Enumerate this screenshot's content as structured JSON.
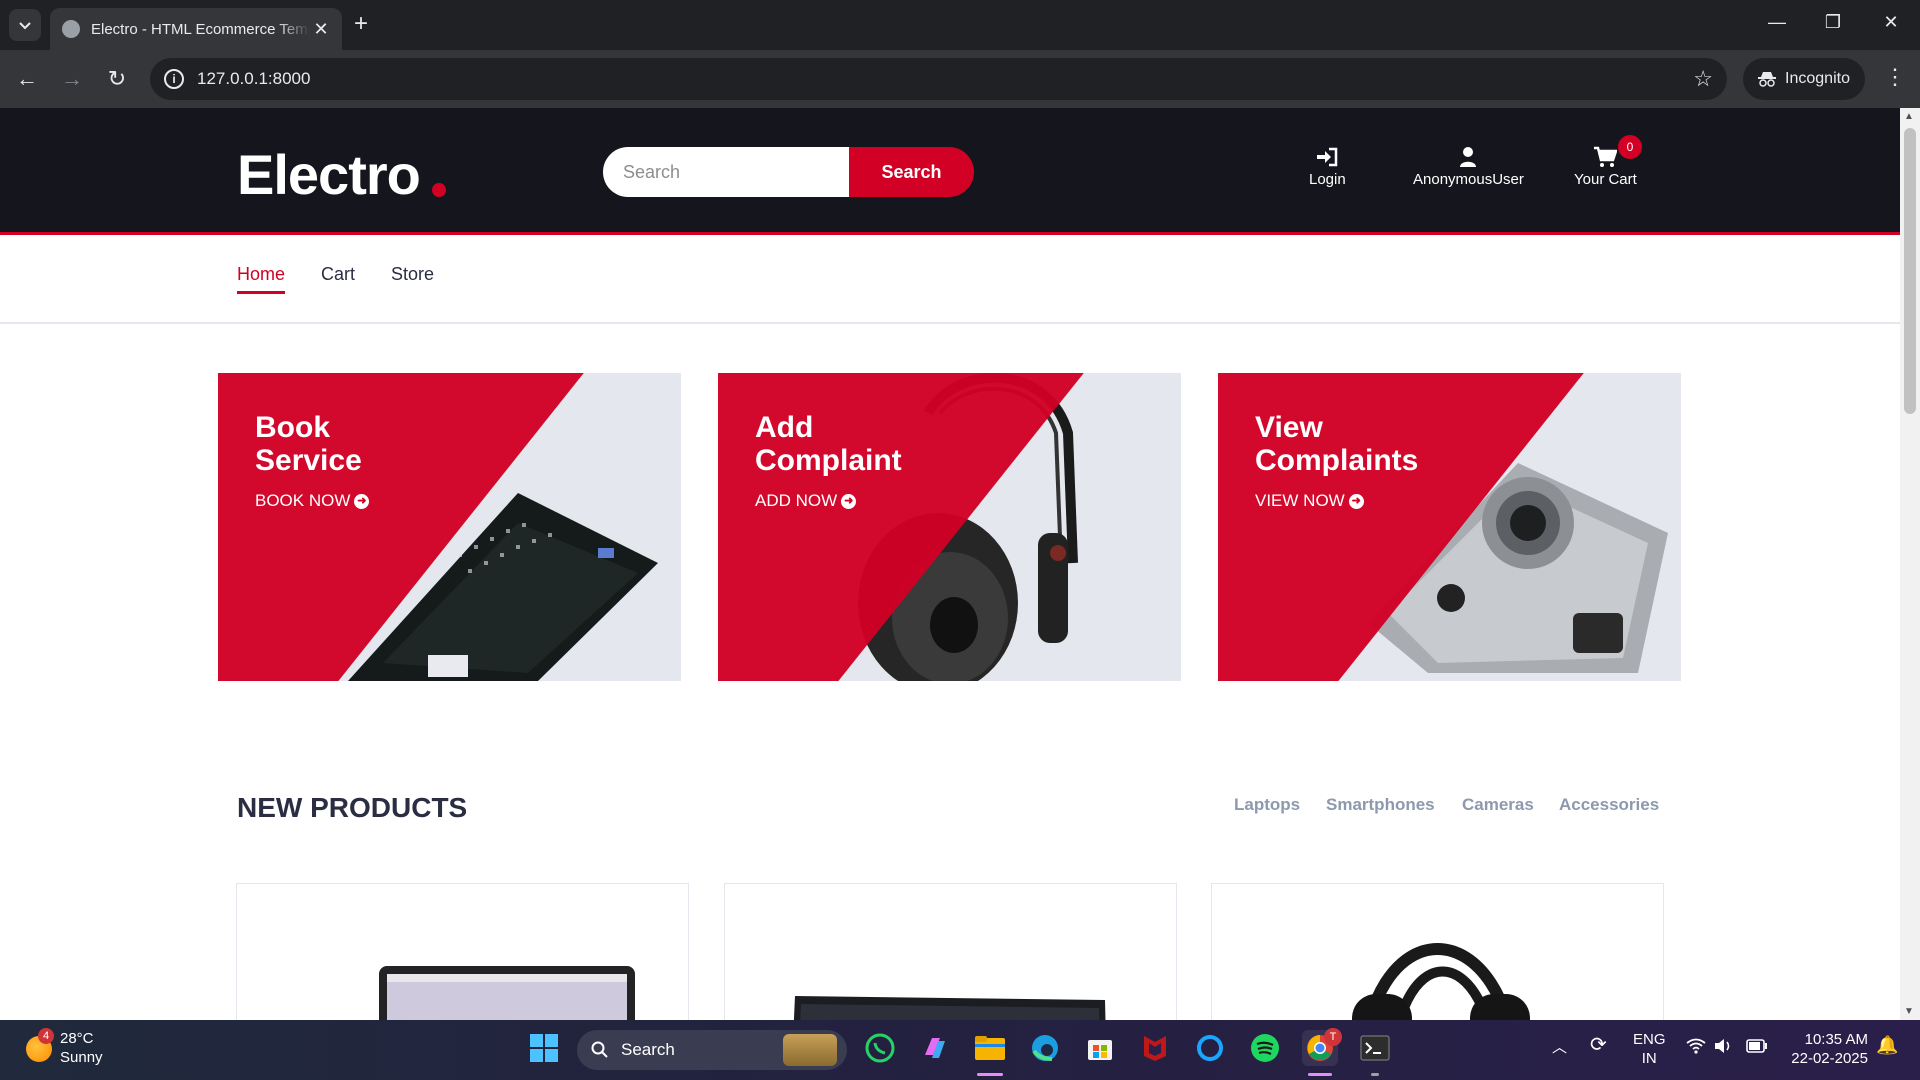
{
  "browser": {
    "tab_title": "Electro - HTML Ecommerce Template",
    "url": "127.0.0.1:8000",
    "incognito_label": "Incognito"
  },
  "header": {
    "logo": "Electro",
    "search_placeholder": "Search",
    "search_button": "Search",
    "login": "Login",
    "user": "AnonymousUser",
    "cart": "Your Cart",
    "cart_count": "0"
  },
  "nav": {
    "items": [
      "Home",
      "Cart",
      "Store"
    ],
    "active": "Home"
  },
  "banners": [
    {
      "line1": "Book",
      "line2": "Service",
      "cta": "BOOK NOW"
    },
    {
      "line1": "Add",
      "line2": "Complaint",
      "cta": "ADD NOW"
    },
    {
      "line1": "View",
      "line2": "Complaints",
      "cta": "VIEW NOW"
    }
  ],
  "new_products": {
    "title": "NEW PRODUCTS",
    "tabs": [
      "Laptops",
      "Smartphones",
      "Cameras",
      "Accessories"
    ]
  },
  "taskbar": {
    "temp": "28°C",
    "weather": "Sunny",
    "weather_badge": "4",
    "search": "Search",
    "lang1": "ENG",
    "lang2": "IN",
    "time": "10:35 AM",
    "date": "22-02-2025",
    "chrome_badge": "T"
  },
  "colors": {
    "brand_red": "#d10024",
    "header_dark": "#15161d"
  }
}
